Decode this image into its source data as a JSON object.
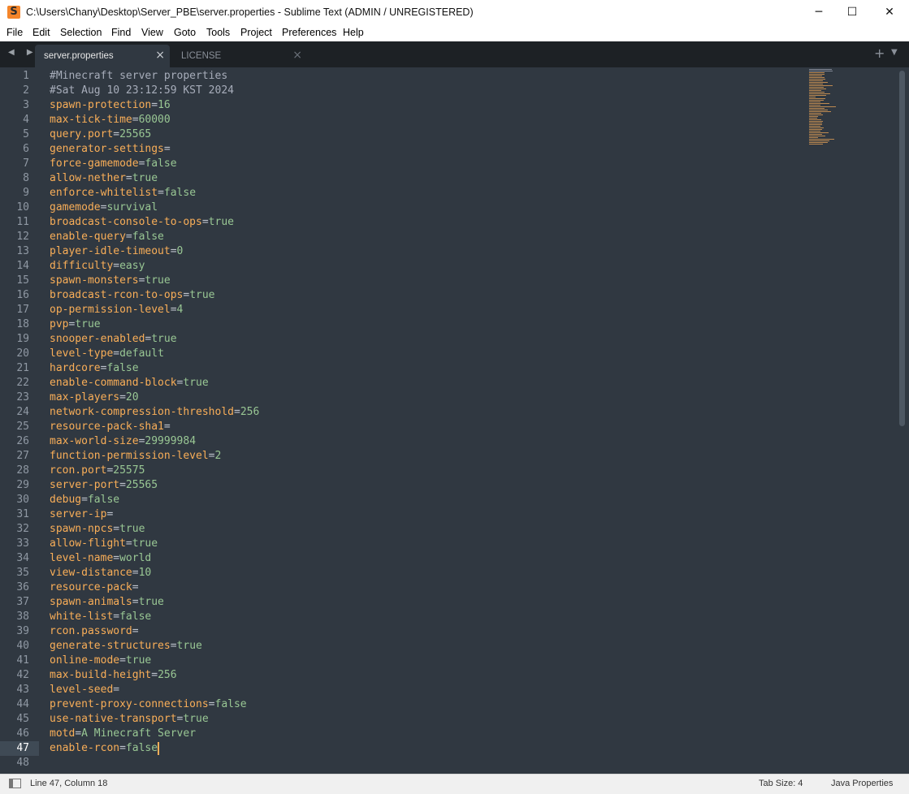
{
  "window": {
    "title": "C:\\Users\\Chany\\Desktop\\Server_PBE\\server.properties - Sublime Text (ADMIN / UNREGISTERED)",
    "app_icon_glyph": "S",
    "minimize_glyph": "─",
    "maximize_glyph": "☐",
    "close_glyph": "✕"
  },
  "menu": {
    "items": [
      "File",
      "Edit",
      "Selection",
      "Find",
      "View",
      "Goto",
      "Tools",
      "Project",
      "Preferences",
      "Help"
    ]
  },
  "tabs": {
    "nav_glyph": "◀ ▶",
    "items": [
      {
        "label": "server.properties",
        "close": "×",
        "active": true
      },
      {
        "label": "LICENSE",
        "close": "×",
        "active": false
      }
    ],
    "add_glyph": "+",
    "menu_glyph": "▼"
  },
  "editor": {
    "current_line": 47,
    "lines": [
      {
        "n": "1",
        "comment": "#Minecraft server properties"
      },
      {
        "n": "2",
        "comment": "#Sat Aug 10 23:12:59 KST 2024"
      },
      {
        "n": "3",
        "key": "spawn-protection",
        "value": "16"
      },
      {
        "n": "4",
        "key": "max-tick-time",
        "value": "60000"
      },
      {
        "n": "5",
        "key": "query.port",
        "value": "25565"
      },
      {
        "n": "6",
        "key": "generator-settings",
        "value": ""
      },
      {
        "n": "7",
        "key": "force-gamemode",
        "value": "false"
      },
      {
        "n": "8",
        "key": "allow-nether",
        "value": "true"
      },
      {
        "n": "9",
        "key": "enforce-whitelist",
        "value": "false"
      },
      {
        "n": "10",
        "key": "gamemode",
        "value": "survival"
      },
      {
        "n": "11",
        "key": "broadcast-console-to-ops",
        "value": "true"
      },
      {
        "n": "12",
        "key": "enable-query",
        "value": "false"
      },
      {
        "n": "13",
        "key": "player-idle-timeout",
        "value": "0"
      },
      {
        "n": "14",
        "key": "difficulty",
        "value": "easy"
      },
      {
        "n": "15",
        "key": "spawn-monsters",
        "value": "true"
      },
      {
        "n": "16",
        "key": "broadcast-rcon-to-ops",
        "value": "true"
      },
      {
        "n": "17",
        "key": "op-permission-level",
        "value": "4"
      },
      {
        "n": "18",
        "key": "pvp",
        "value": "true"
      },
      {
        "n": "19",
        "key": "snooper-enabled",
        "value": "true"
      },
      {
        "n": "20",
        "key": "level-type",
        "value": "default"
      },
      {
        "n": "21",
        "key": "hardcore",
        "value": "false"
      },
      {
        "n": "22",
        "key": "enable-command-block",
        "value": "true"
      },
      {
        "n": "23",
        "key": "max-players",
        "value": "20"
      },
      {
        "n": "24",
        "key": "network-compression-threshold",
        "value": "256"
      },
      {
        "n": "25",
        "key": "resource-pack-sha1",
        "value": ""
      },
      {
        "n": "26",
        "key": "max-world-size",
        "value": "29999984"
      },
      {
        "n": "27",
        "key": "function-permission-level",
        "value": "2"
      },
      {
        "n": "28",
        "key": "rcon.port",
        "value": "25575"
      },
      {
        "n": "29",
        "key": "server-port",
        "value": "25565"
      },
      {
        "n": "30",
        "key": "debug",
        "value": "false"
      },
      {
        "n": "31",
        "key": "server-ip",
        "value": ""
      },
      {
        "n": "32",
        "key": "spawn-npcs",
        "value": "true"
      },
      {
        "n": "33",
        "key": "allow-flight",
        "value": "true"
      },
      {
        "n": "34",
        "key": "level-name",
        "value": "world"
      },
      {
        "n": "35",
        "key": "view-distance",
        "value": "10"
      },
      {
        "n": "36",
        "key": "resource-pack",
        "value": ""
      },
      {
        "n": "37",
        "key": "spawn-animals",
        "value": "true"
      },
      {
        "n": "38",
        "key": "white-list",
        "value": "false"
      },
      {
        "n": "39",
        "key": "rcon.password",
        "value": ""
      },
      {
        "n": "40",
        "key": "generate-structures",
        "value": "true"
      },
      {
        "n": "41",
        "key": "online-mode",
        "value": "true"
      },
      {
        "n": "42",
        "key": "max-build-height",
        "value": "256"
      },
      {
        "n": "43",
        "key": "level-seed",
        "value": ""
      },
      {
        "n": "44",
        "key": "prevent-proxy-connections",
        "value": "false"
      },
      {
        "n": "45",
        "key": "use-native-transport",
        "value": "true"
      },
      {
        "n": "46",
        "key": "motd",
        "value": "A Minecraft Server"
      },
      {
        "n": "47",
        "key": "enable-rcon",
        "value": "false"
      },
      {
        "n": "48",
        "empty": true
      }
    ]
  },
  "status": {
    "position": "Line 47, Column 18",
    "tab_size": "Tab Size: 4",
    "syntax": "Java Properties"
  },
  "colors": {
    "editor_bg": "#303841",
    "key": "#f9ae58",
    "value": "#99c794",
    "comment": "#a7adba",
    "caret": "#f9ae58"
  }
}
